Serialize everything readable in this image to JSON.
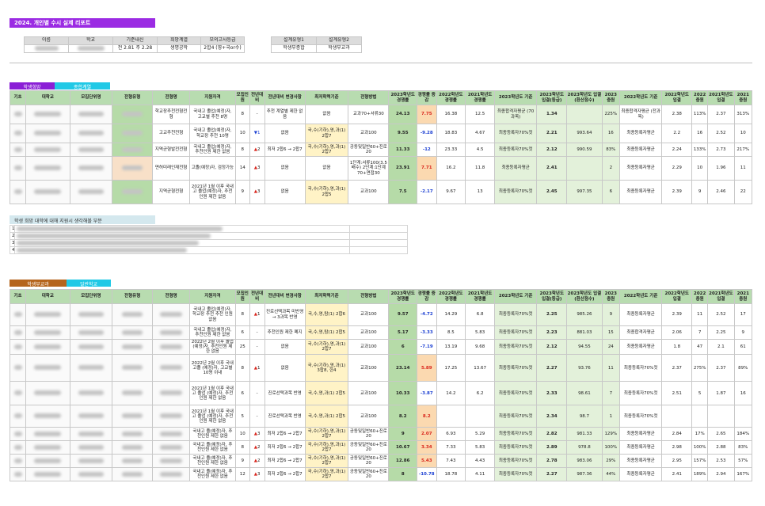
{
  "report_title": "2024. 개인별 수시 실제 리포트",
  "info": {
    "headers": [
      "이름",
      "학교",
      "기준내신",
      "희망계열",
      "모의고사등급"
    ],
    "values": [
      "",
      "",
      "전 2.81 주 2.28",
      "생명공학",
      "2합4 (영+국or수)"
    ],
    "headers2": [
      "설계유형1",
      "설계유형2"
    ],
    "values2": [
      "학생부종합",
      "학생부교과"
    ]
  },
  "section1": {
    "tag_left": "학생희망",
    "tag_right": "종합계열",
    "tag_left_color": "#8a1fd6",
    "tag_right_color": "#21c9e6"
  },
  "section2": {
    "tag_left": "학생부교과",
    "tag_right": "일반학교",
    "tag_left_color": "#b5651d",
    "tag_right_color": "#21c9e6"
  },
  "notes_title": "학생 희망 대학에 대해 지원시 생각해볼 부분",
  "notes_rows": [
    "1",
    "2",
    "3",
    "4"
  ],
  "table_headers": [
    "기초",
    "대학교",
    "모집단위명",
    "전형유형",
    "전형명",
    "지원자격",
    "모집인원",
    "전년대비",
    "전년대비 변경사항",
    "최저학력기준",
    "전형방법",
    "2023학년도 경쟁률",
    "경쟁률 증감",
    "2022학년도 경쟁률",
    "2021학년도 경쟁률",
    "2023학년도 기준",
    "2023학년도 입결(등급)",
    "2023학년도 입결(환산점수)",
    "2023 충원",
    "2022학년도 기준",
    "2022학년도 입결",
    "2022 충원",
    "2021학년도 입결",
    "2021 충원"
  ],
  "table1_rows": [
    {
      "jeonhyeong": "학교장추천전형전형",
      "jagyeok": "국내고 졸업(예정)자, 고교별 추천 8명",
      "inwon": "8",
      "arrow": "",
      "delta": "-",
      "change": "추천 계열별 제한 없음",
      "choejeo": "없음",
      "method": "교과70+서류30",
      "c23": "24.13",
      "cdelta": "7.75",
      "c22": "16.38",
      "c21": "12.5",
      "std23": "최종합격자평균 (70과목)",
      "ip23": "1.34",
      "score23": "",
      "chung23": "225%",
      "std22": "최종합격자평균 (전과목)",
      "ip22": "2.38",
      "chung22": "113%",
      "ip21": "2.37",
      "chung21": "313%",
      "choejeo_yellow": false,
      "cdelta_bg": "o"
    },
    {
      "jeonhyeong": "고교추천전형",
      "jagyeok": "국내고 졸업(예정)자, 학교장 추천 10명",
      "inwon": "10",
      "arrow": "▼",
      "delta": "1",
      "change": "없음",
      "choejeo": "국,수(기하),영,과(1) 2합7",
      "method": "교과100",
      "c23": "9.55",
      "cdelta": "-9.28",
      "c22": "18.83",
      "c21": "4.67",
      "std23": "최종등록자70%컷",
      "ip23": "2.21",
      "score23": "993.64",
      "chung23": "16",
      "std22": "최종등록자평균",
      "ip22": "2.2",
      "chung22": "16",
      "ip21": "2.52",
      "chung21": "10",
      "choejeo_yellow": true,
      "cdelta_bg": "none"
    },
    {
      "jeonhyeong": "지역균형발전전형",
      "jagyeok": "국내고 졸업(예정)자, 추천인원 제한 없음",
      "inwon": "8",
      "arrow": "▲",
      "delta": "2",
      "change": "최저 2합6 → 2합7",
      "choejeo": "국,수(기하),영,과(1) 2합7",
      "method": "공동및일반60+진로20",
      "c23": "11.33",
      "cdelta": "-12",
      "c22": "23.33",
      "c21": "4.5",
      "std23": "최종등록자70%컷",
      "ip23": "2.12",
      "score23": "990.59",
      "chung23": "83%",
      "std22": "최종등록자평균",
      "ip22": "2.24",
      "chung22": "133%",
      "ip21": "2.73",
      "chung21": "217%",
      "choejeo_yellow": true,
      "cdelta_bg": "none"
    },
    {
      "jeonhyeong": "면허미래인재전형",
      "jagyeok": "고졸(예정)자, 검정가능",
      "inwon": "14",
      "arrow": "▲",
      "delta": "3",
      "change": "없음",
      "choejeo": "없음",
      "method": "1단계:서류100(3.5배수) 2단계:1단계70+면접30",
      "c23": "23.91",
      "cdelta": "7.71",
      "c22": "16.2",
      "c21": "11.8",
      "std23": "최종등록자평균",
      "ip23": "2.41",
      "score23": "",
      "chung23": "2",
      "std22": "최종등록자평균",
      "ip22": "2.29",
      "chung22": "10",
      "ip21": "1.96",
      "chung21": "11",
      "choejeo_yellow": false,
      "cdelta_bg": "o"
    },
    {
      "jeonhyeong": "지역균형전형",
      "jagyeok": "2021년 1월 이후 국내고 졸업(예정)자, 추천인원 제한 없음",
      "inwon": "9",
      "arrow": "▲",
      "delta": "3",
      "change": "없음",
      "choejeo": "국,수(기하),영,과(1) 2합5",
      "method": "교과100",
      "c23": "7.5",
      "cdelta": "-2.17",
      "c22": "9.67",
      "c21": "13",
      "std23": "최종등록자70%컷",
      "ip23": "2.45",
      "score23": "997.35",
      "chung23": "6",
      "std22": "최종등록자평균",
      "ip22": "2.39",
      "chung22": "9",
      "ip21": "2.46",
      "chung21": "22",
      "choejeo_yellow": true,
      "cdelta_bg": "none"
    }
  ],
  "table2_rows": [
    {
      "jagyeok": "국내고 졸업(예정)자, 학교장 추천 추천 인원 없음",
      "inwon": "8",
      "arrow": "▲",
      "delta": "1",
      "change": "진로선택과목 미반영 → 3과목 반영",
      "choejeo": "국,수,영,탐(1) 2합6",
      "method": "교과100",
      "c23": "9.57",
      "cdelta": "-4.72",
      "c22": "14.29",
      "c21": "6.8",
      "std23": "최종등록자70%컷",
      "ip23": "2.25",
      "score23": "985.26",
      "chung23": "9",
      "std22": "최종등록자평균",
      "ip22": "2.39",
      "chung22": "11",
      "ip21": "2.52",
      "chung21": "17"
    },
    {
      "jagyeok": "국내고 졸업(예정)자, 추천인원 제한 없음",
      "inwon": "6",
      "arrow": "",
      "delta": "-",
      "change": "추천인원 제한 폐지",
      "choejeo": "국,수,영,탐(1) 2합5",
      "method": "교과100",
      "c23": "5.17",
      "cdelta": "-3.33",
      "c22": "8.5",
      "c21": "5.83",
      "std23": "최종등록자70%컷",
      "ip23": "2.23",
      "score23": "881.03",
      "chung23": "15",
      "std22": "최종합격자평균",
      "ip22": "2.06",
      "chung22": "7",
      "ip21": "2.25",
      "chung21": "9"
    },
    {
      "jagyeok": "2022년 2월 이후 졸업(예정)자, 추천인원 제한 없음",
      "inwon": "25",
      "arrow": "",
      "delta": "-",
      "change": "없음",
      "choejeo": "국,수(기하),영,과(1) 2합7",
      "method": "교과100",
      "c23": "6",
      "cdelta": "-7.19",
      "c22": "13.19",
      "c21": "9.68",
      "std23": "최종등록자70%컷",
      "ip23": "2.12",
      "score23": "94.55",
      "chung23": "24",
      "std22": "최종등록자평균",
      "ip22": "1.8",
      "chung22": "47",
      "ip21": "2.1",
      "chung21": "61"
    },
    {
      "jagyeok": "2022년 2월 이후 국내고졸 (예정)자, 고교별 10명 이내",
      "inwon": "8",
      "arrow": "▲",
      "delta": "1",
      "change": "없음",
      "choejeo": "국,수(기하),영,과(1) 3합8, 한4",
      "method": "교과100",
      "c23": "23.14",
      "cdelta": "5.89",
      "c22": "17.25",
      "c21": "13.67",
      "std23": "최종등록자70%컷",
      "ip23": "2.27",
      "score23": "93.76",
      "chung23": "11",
      "std22": "최종등록자70%컷",
      "ip22": "2.37",
      "chung22": "275%",
      "ip21": "2.37",
      "chung21": "89%"
    },
    {
      "jagyeok": "2021년 1월 이후 국내고 졸업 (예정)자, 추천 인원 제한 없음",
      "inwon": "6",
      "arrow": "",
      "delta": "-",
      "change": "진로선택과목 반영",
      "choejeo": "국,수,영,과(1) 2합5",
      "method": "교과100",
      "c23": "10.33",
      "cdelta": "-3.87",
      "c22": "14.2",
      "c21": "6.2",
      "std23": "최종등록자70%컷",
      "ip23": "2.33",
      "score23": "98.61",
      "chung23": "7",
      "std22": "최종등록자70%컷",
      "ip22": "2.51",
      "chung22": "5",
      "ip21": "1.87",
      "chung21": "16"
    },
    {
      "jagyeok": "2021년 1월 이후 국내고 졸업 (예정)자, 추천 인원 제한 없음",
      "inwon": "5",
      "arrow": "",
      "delta": "-",
      "change": "진로선택과목 반영",
      "choejeo": "국,수,영,과(1) 2합5",
      "method": "교과100",
      "c23": "8.2",
      "cdelta": "8.2",
      "c22": "",
      "c21": "",
      "std23": "최종등록자70%컷",
      "ip23": "2.34",
      "score23": "98.7",
      "chung23": "1",
      "std22": "최종등록자70%컷",
      "ip22": "",
      "chung22": "",
      "ip21": "",
      "chung21": ""
    },
    {
      "jagyeok": "국내고 졸(예정)자, 추천인원 제한 없음",
      "inwon": "10",
      "arrow": "▲",
      "delta": "3",
      "change": "최저 2합6 → 2합7",
      "choejeo": "국,수(기하),영,과(1) 2합7",
      "method": "공동및일반60+진로20",
      "c23": "9",
      "cdelta": "2.07",
      "c22": "6.93",
      "c21": "5.29",
      "std23": "최종등록자70%컷",
      "ip23": "2.82",
      "score23": "981.33",
      "chung23": "129%",
      "std22": "최종등록자평균",
      "ip22": "2.84",
      "chung22": "17%",
      "ip21": "2.65",
      "chung21": "184%"
    },
    {
      "jagyeok": "국내고 졸(예정)자, 추천인원 제한 없음",
      "inwon": "8",
      "arrow": "▲",
      "delta": "2",
      "change": "최저 2합6 → 2합7",
      "choejeo": "국,수(기하),영,과(1) 2합7",
      "method": "공동및일반60+진로20",
      "c23": "10.67",
      "cdelta": "3.34",
      "c22": "7.33",
      "c21": "5.83",
      "std23": "최종등록자70%컷",
      "ip23": "2.89",
      "score23": "978.8",
      "chung23": "100%",
      "std22": "최종등록자평균",
      "ip22": "2.98",
      "chung22": "100%",
      "ip21": "2.88",
      "chung21": "83%"
    },
    {
      "jagyeok": "국내고 졸(예정)자, 추천인원 제한 없음",
      "inwon": "9",
      "arrow": "▲",
      "delta": "2",
      "change": "최저 2합6 → 2합7",
      "choejeo": "국,수(기하),영,과(1) 2합7",
      "method": "공동및일반60+진로20",
      "c23": "12.86",
      "cdelta": "5.43",
      "c22": "7.43",
      "c21": "4.43",
      "std23": "최종등록자70%컷",
      "ip23": "2.78",
      "score23": "983.06",
      "chung23": "29%",
      "std22": "최종등록자평균",
      "ip22": "2.95",
      "chung22": "157%",
      "ip21": "2.53",
      "chung21": "57%"
    },
    {
      "jagyeok": "국내고 졸(예정)자, 추천인원 제한 없음",
      "inwon": "12",
      "arrow": "▲",
      "delta": "3",
      "change": "최저 2합6 → 2합7",
      "choejeo": "국,수(기하),영,과(1) 2합7",
      "method": "공동및일반60+진로20",
      "c23": "8",
      "cdelta": "-10.78",
      "c22": "18.78",
      "c21": "4.11",
      "std23": "최종등록자70%컷",
      "ip23": "2.27",
      "score23": "987.36",
      "chung23": "44%",
      "std22": "최종등록자평균",
      "ip22": "2.41",
      "chung22": "189%",
      "ip21": "2.94",
      "chung21": "167%"
    }
  ]
}
